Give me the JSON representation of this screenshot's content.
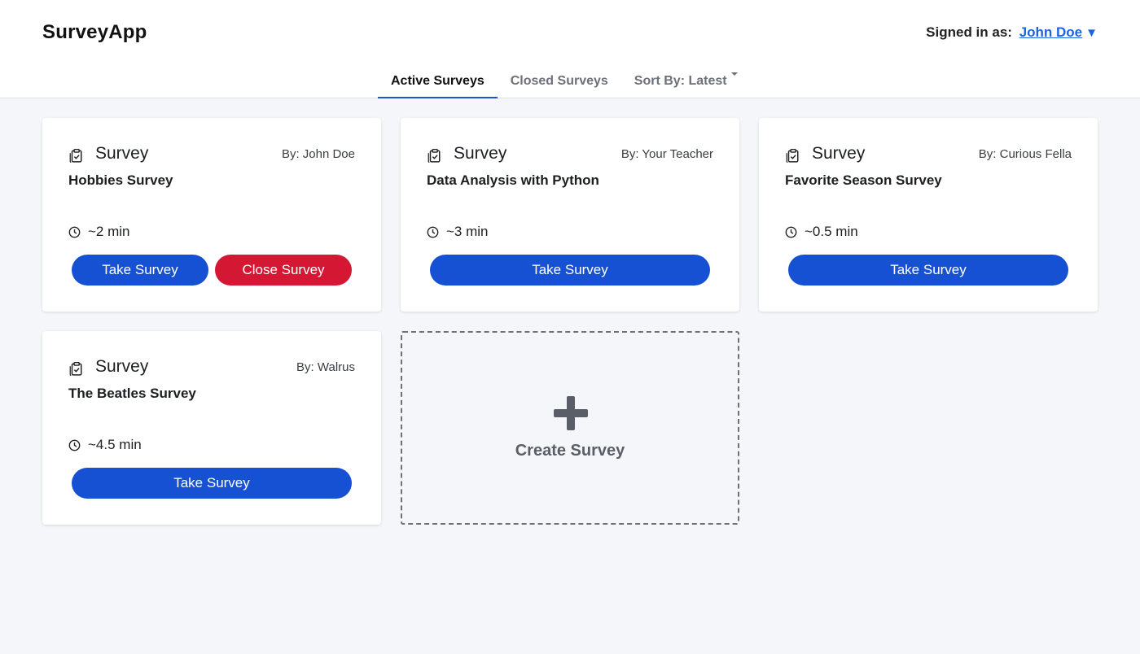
{
  "app": {
    "title": "SurveyApp"
  },
  "header": {
    "signed_in_label": "Signed in as:",
    "user_name": "John Doe",
    "user_caret": "▼"
  },
  "tabs": [
    {
      "label": "Active Surveys",
      "active": true
    },
    {
      "label": "Closed Surveys",
      "active": false
    },
    {
      "label": "Sort By: Latest",
      "active": false,
      "dropdown": true
    }
  ],
  "surveys": [
    {
      "type": "Survey",
      "author": "By: John Doe",
      "title": "Hobbies Survey",
      "duration": "~2 min",
      "take_label": "Take Survey",
      "close_label": "Close Survey"
    },
    {
      "type": "Survey",
      "author": "By: Your Teacher",
      "title": "Data Analysis with Python",
      "duration": "~3 min",
      "take_label": "Take Survey"
    },
    {
      "type": "Survey",
      "author": "By: Curious Fella",
      "title": "Favorite Season Survey",
      "duration": "~0.5 min",
      "take_label": "Take Survey"
    },
    {
      "type": "Survey",
      "author": "By: Walrus",
      "title": "The Beatles Survey",
      "duration": "~4.5 min",
      "take_label": "Take Survey"
    }
  ],
  "create": {
    "label": "Create Survey"
  },
  "icons": {
    "survey": "clipboard-check-icon",
    "duration": "clock-icon",
    "create": "plus-icon",
    "user_menu": "caret-down-icon"
  },
  "colors": {
    "primary": "#1651d4",
    "danger": "#d41733",
    "link": "#1a66e0",
    "background": "#f4f6fa"
  }
}
